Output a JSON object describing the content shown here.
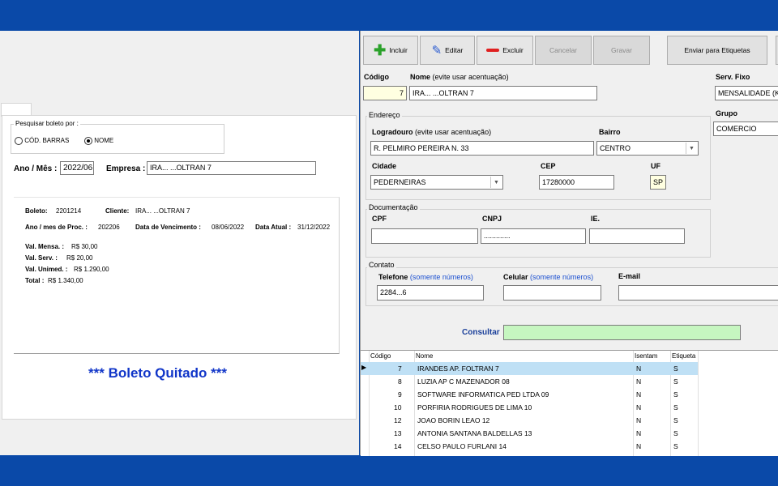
{
  "left": {
    "search_group_label": "Pesquisar boleto por :",
    "radio_barcode": "CÓD. BARRAS",
    "radio_name": "NOME",
    "ano_mes_label": "Ano / Mês :",
    "ano_mes_value": "2022/06",
    "empresa_label": "Empresa :",
    "empresa_value": "IRA... ...OLTRAN 7",
    "boleto_label": "Boleto:",
    "boleto_value": "2201214",
    "cliente_label": "Cliente:",
    "cliente_value": "IRA... ...OLTRAN 7",
    "ano_proc_label": "Ano / mes de Proc. :",
    "ano_proc_value": "202206",
    "vencimento_label": "Data de Vencimento :",
    "vencimento_value": "08/06/2022",
    "data_atual_label": "Data Atual :",
    "data_atual_value": "31/12/2022",
    "val_mensa_label": "Val. Mensa. :",
    "val_mensa_value": "R$ 30,00",
    "val_serv_label": "Val. Serv. :",
    "val_serv_value": "R$ 20,00",
    "val_unimed_label": "Val. Unimed. :",
    "val_unimed_value": "R$ 1.290,00",
    "total_label": "Total :",
    "total_value": "R$ 1.340,00",
    "status_message": "*** Boleto Quitado ***"
  },
  "toolbar": {
    "incluir": "Incluir",
    "editar": "Editar",
    "excluir": "Excluir",
    "cancelar": "Cancelar",
    "gravar": "Gravar",
    "enviar": "Enviar para Etiquetas"
  },
  "form": {
    "codigo_label": "Código",
    "codigo_value": "7",
    "nome_label": "Nome",
    "nome_hint": "(evite usar acentuação)",
    "nome_value": "IRA... ...OLTRAN 7",
    "serv_fixo_label": "Serv. Fixo",
    "serv_fixo_value": "MENSALIDADE (K",
    "grupo_label": "Grupo",
    "grupo_value": "COMERCIO",
    "endereco_legend": "Endereço",
    "logradouro_label": "Logradouro",
    "logradouro_hint": "(evite usar acentuação)",
    "logradouro_value": "R. PELMIRO PEREIRA N. 33",
    "bairro_label": "Bairro",
    "bairro_value": "CENTRO",
    "cidade_label": "Cidade",
    "cidade_value": "PEDERNEIRAS",
    "cep_label": "CEP",
    "cep_value": "17280000",
    "uf_label": "UF",
    "uf_value": "SP",
    "documentacao_legend": "Documentação",
    "cpf_label": "CPF",
    "cpf_value": "",
    "cnpj_label": "CNPJ",
    "cnpj_value": ".............",
    "ie_label": "IE.",
    "ie_value": "",
    "contato_legend": "Contato",
    "telefone_label": "Telefone",
    "telefone_hint": "(somente números)",
    "telefone_value": "2284...6",
    "celular_label": "Celular",
    "celular_hint": "(somente números)",
    "celular_value": "",
    "email_label": "E-mail",
    "email_value": "",
    "consultar_label": "Consultar",
    "consultar_value": ""
  },
  "grid": {
    "headers": [
      "Código",
      "Nome",
      "Isentam",
      "Etiqueta"
    ],
    "rows": [
      {
        "codigo": "7",
        "nome": "IRANDES AP. FOLTRAN 7",
        "isentam": "N",
        "etiqueta": "S"
      },
      {
        "codigo": "8",
        "nome": "LUZIA AP C MAZENADOR 08",
        "isentam": "N",
        "etiqueta": "S"
      },
      {
        "codigo": "9",
        "nome": "SOFTWARE INFORMATICA PED LTDA 09",
        "isentam": "N",
        "etiqueta": "S"
      },
      {
        "codigo": "10",
        "nome": "PORFIRIA RODRIGUES DE LIMA 10",
        "isentam": "N",
        "etiqueta": "S"
      },
      {
        "codigo": "12",
        "nome": "JOAO BORIN LEAO  12",
        "isentam": "N",
        "etiqueta": "S"
      },
      {
        "codigo": "13",
        "nome": "ANTONIA SANTANA BALDELLAS 13",
        "isentam": "N",
        "etiqueta": "S"
      },
      {
        "codigo": "14",
        "nome": "CELSO PAULO FURLANI 14",
        "isentam": "N",
        "etiqueta": "S"
      }
    ]
  },
  "colors": {
    "background": "#0a49a8",
    "status_blue": "#1035c8",
    "selected_row": "#bfe0f5",
    "codigo_field": "#ffffe1",
    "consultar_field": "#c6f6c0"
  }
}
